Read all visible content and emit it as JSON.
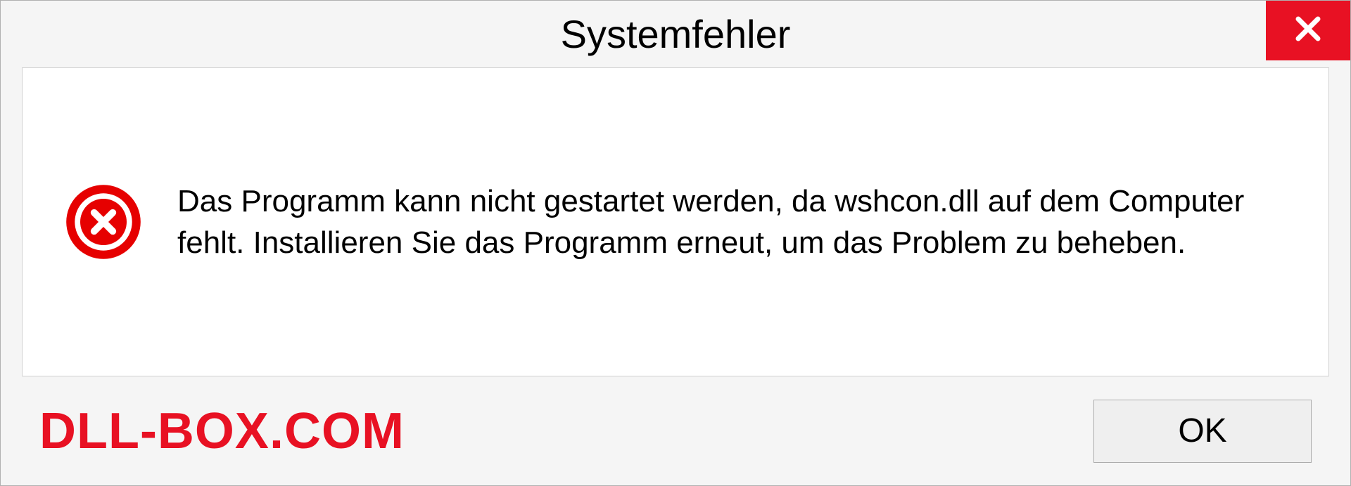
{
  "dialog": {
    "title": "Systemfehler",
    "message": "Das Programm kann nicht gestartet werden, da wshcon.dll auf dem Computer fehlt. Installieren Sie das Programm erneut, um das Problem zu beheben.",
    "ok_label": "OK"
  },
  "watermark": "DLL-BOX.COM",
  "colors": {
    "close_bg": "#e81123",
    "watermark": "#e81123"
  }
}
